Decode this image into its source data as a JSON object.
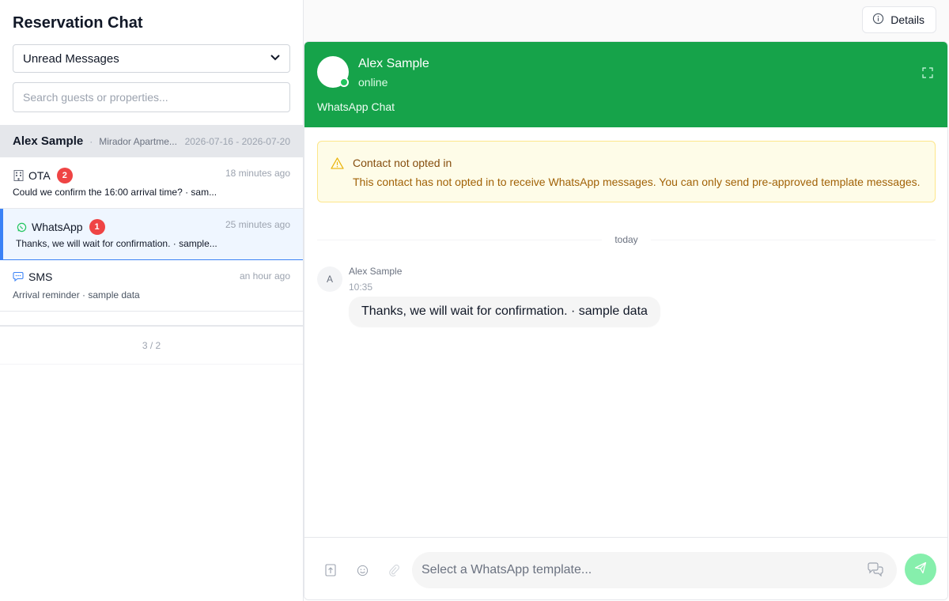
{
  "sidebar": {
    "title": "Reservation Chat",
    "filter": {
      "selected": "Unread Messages"
    },
    "search": {
      "placeholder": "Search guests or properties..."
    },
    "group": {
      "guest_name": "Alex Sample",
      "separator": "·",
      "property": "Mirador Apartme...",
      "dates": "2026-07-16 - 2026-07-20"
    },
    "conversations": [
      {
        "channel": "OTA",
        "icon": "building-icon",
        "unread": "2",
        "time": "18 minutes ago",
        "preview": "Could we confirm the 16:00 arrival time? · sam..."
      },
      {
        "channel": "WhatsApp",
        "icon": "whatsapp-icon",
        "unread": "1",
        "time": "25 minutes ago",
        "preview": "Thanks, we will wait for confirmation. · sample..."
      },
      {
        "channel": "SMS",
        "icon": "sms-icon",
        "unread": "",
        "time": "an hour ago",
        "preview": "Arrival reminder · sample data"
      }
    ],
    "pager": "3 / 2"
  },
  "topbar": {
    "details_label": "Details"
  },
  "chat": {
    "contact_name": "Alex Sample",
    "contact_status": "online",
    "channel_label": "WhatsApp Chat",
    "warning": {
      "title": "Contact not opted in",
      "text": "This contact has not opted in to receive WhatsApp messages. You can only send pre-approved template messages."
    },
    "day_label": "today",
    "messages": [
      {
        "avatar_initial": "A",
        "sender": "Alex Sample",
        "time": "10:35",
        "text": "Thanks, we will wait for confirmation. · sample data"
      }
    ],
    "composer": {
      "placeholder": "Select a WhatsApp template..."
    }
  },
  "colors": {
    "header_green": "#16a34a",
    "unread_badge": "#ef4444",
    "active_accent": "#3b82f6",
    "warning_bg": "#fefce8",
    "send_button": "#86efac"
  }
}
